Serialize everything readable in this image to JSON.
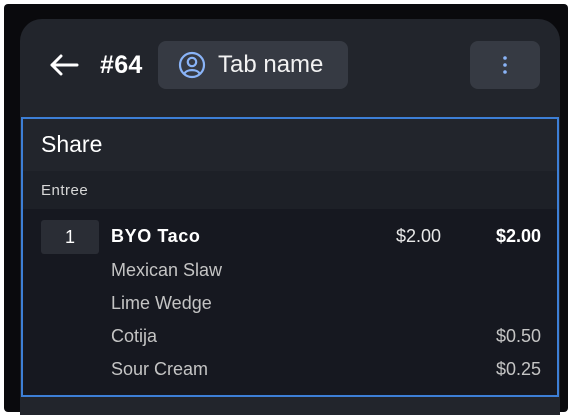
{
  "header": {
    "back_icon": "arrow-left-icon",
    "order_number": "#64",
    "tab_button": {
      "icon": "person-circle-icon",
      "label": "Tab name"
    },
    "more_icon": "vertical-dots-icon"
  },
  "panel": {
    "title": "Share",
    "category": "Entree",
    "item": {
      "quantity": "1",
      "name": "BYO Taco",
      "unit_price": "$2.00",
      "total_price": "$2.00",
      "modifiers": [
        {
          "name": "Mexican Slaw",
          "price": ""
        },
        {
          "name": "Lime Wedge",
          "price": ""
        },
        {
          "name": "Cotija",
          "price": "$0.50"
        },
        {
          "name": "Sour Cream",
          "price": "$0.25"
        }
      ]
    }
  },
  "colors": {
    "accent": "#3d7fd6",
    "icon_blue": "#8ab4f8",
    "background": "#22252c",
    "panel_background": "#161820"
  }
}
